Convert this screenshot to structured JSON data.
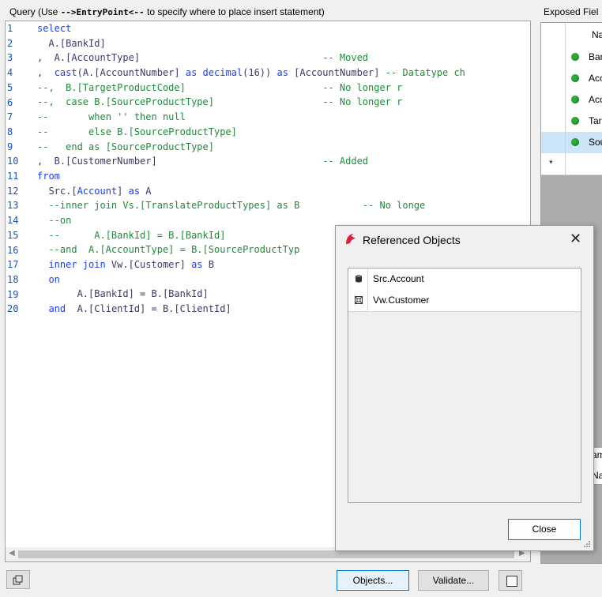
{
  "query": {
    "label": "Query (Use -->EntryPoint<-- to specify where to place insert statement)",
    "label_prefix": "Query (Use ",
    "label_entry": "-->EntryPoint<--",
    "label_suffix": " to specify where to place insert statement)",
    "line_numbers": [
      "1",
      "2",
      "3",
      "4",
      "5",
      "6",
      "7",
      "8",
      "9",
      "10",
      "11",
      "12",
      "13",
      "14",
      "15",
      "16",
      "17",
      "18",
      "19",
      "20"
    ],
    "lines": [
      [
        {
          "t": "select",
          "c": "kw"
        }
      ],
      [
        {
          "t": "  A.[BankId]",
          "c": "id"
        }
      ],
      [
        {
          "t": ",  A.[AccountType]                                ",
          "c": "id"
        },
        {
          "t": "-- Moved",
          "c": "cm"
        }
      ],
      [
        {
          "t": ",  ",
          "c": "id"
        },
        {
          "t": "cast",
          "c": "kw"
        },
        {
          "t": "(A.[AccountNumber] ",
          "c": "id"
        },
        {
          "t": "as decimal",
          "c": "kw"
        },
        {
          "t": "(16)) ",
          "c": "id"
        },
        {
          "t": "as",
          "c": "kw"
        },
        {
          "t": " [AccountNumber] ",
          "c": "id"
        },
        {
          "t": "-- Datatype ch",
          "c": "cm"
        }
      ],
      [
        {
          "t": "--,  B.[TargetProductCode]                        -- No longer r",
          "c": "cm"
        }
      ],
      [
        {
          "t": "--,  case B.[SourceProductType]                   -- No longer r",
          "c": "cm"
        }
      ],
      [
        {
          "t": "--       when '' then null",
          "c": "cm"
        }
      ],
      [
        {
          "t": "--       else B.[SourceProductType]",
          "c": "cm"
        }
      ],
      [
        {
          "t": "--   end as [SourceProductType]",
          "c": "cm"
        }
      ],
      [
        {
          "t": ",  B.[CustomerNumber]                             ",
          "c": "id"
        },
        {
          "t": "-- Added",
          "c": "cm"
        }
      ],
      [
        {
          "t": "from",
          "c": "kw"
        }
      ],
      [
        {
          "t": "  Src.[",
          "c": "id"
        },
        {
          "t": "Account",
          "c": "kw"
        },
        {
          "t": "] ",
          "c": "id"
        },
        {
          "t": "as",
          "c": "kw"
        },
        {
          "t": " A",
          "c": "id"
        }
      ],
      [
        {
          "t": "  --inner join Vs.[TranslateProductTypes] as B           -- No longe",
          "c": "cm"
        }
      ],
      [
        {
          "t": "  --on",
          "c": "cm"
        }
      ],
      [
        {
          "t": "  --      A.[BankId] = B.[BankId]",
          "c": "cm"
        }
      ],
      [
        {
          "t": "  --and  A.[AccountType] = B.[SourceProductTyp",
          "c": "cm"
        }
      ],
      [
        {
          "t": "  ",
          "c": "id"
        },
        {
          "t": "inner join",
          "c": "kw"
        },
        {
          "t": " Vw.[Customer] ",
          "c": "id"
        },
        {
          "t": "as",
          "c": "kw"
        },
        {
          "t": " B",
          "c": "id"
        }
      ],
      [
        {
          "t": "  ",
          "c": "id"
        },
        {
          "t": "on",
          "c": "kw"
        }
      ],
      [
        {
          "t": "       A.[BankId] = B.[BankId]",
          "c": "id"
        }
      ],
      [
        {
          "t": "  ",
          "c": "id"
        },
        {
          "t": "and",
          "c": "kw"
        },
        {
          "t": "  A.[ClientId] = B.[ClientId]",
          "c": "id"
        }
      ]
    ]
  },
  "exposed": {
    "label": "Exposed Fiel",
    "header": "Na",
    "rows": [
      "Bar",
      "Acc",
      "Acc",
      "Tar",
      "Sou"
    ],
    "new_row_marker": "*",
    "bottom_label_1": "am",
    "bottom_label_2": "Na"
  },
  "buttons": {
    "objects": "Objects...",
    "validate": "Validate..."
  },
  "dialog": {
    "title": "Referenced Objects",
    "close_glyph": "✕",
    "items": [
      {
        "label": "Src.Account",
        "icon": "table-icon"
      },
      {
        "label": "Vw.Customer",
        "icon": "view-icon"
      }
    ],
    "close_button": "Close"
  },
  "colors": {
    "keyword": "#1a3cff",
    "comment": "#1f8a3a",
    "identifier": "#3a3a6a",
    "line_number": "#1a4fc7",
    "status_green": "#2eaa3a",
    "selection": "#cce4f7"
  }
}
